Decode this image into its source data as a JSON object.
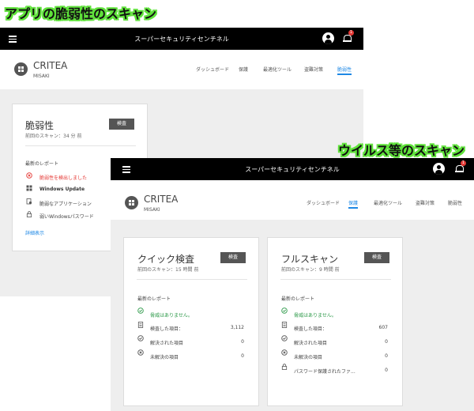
{
  "captions": {
    "top": "アプリの脆弱性のスキャン",
    "mid": "ウイルス等のスキャン"
  },
  "app_title": "スーパーセキュリティセンチネル",
  "notification_count": "1",
  "brand": "CRITEA",
  "user": "MISAKI",
  "nav": [
    "ダッシュボード",
    "保護",
    "最適化ツール",
    "盗難対策",
    "脆弱性"
  ],
  "screen1": {
    "active_tab": "脆弱性",
    "card": {
      "title": "脆弱性",
      "last_scan": "前回のスキャン：34 分 前",
      "button": "検査",
      "report_heading": "最新のレポート",
      "rows": [
        "脆弱性を検出しました",
        "Windows Update",
        "脆弱なアプリケーション",
        "弱いWindowsパスワード"
      ],
      "details_link": "詳細表示"
    }
  },
  "screen2": {
    "active_tab": "保護",
    "quick": {
      "title": "クイック検査",
      "last_scan": "前回のスキャン：15 時間 前",
      "button": "検査",
      "report_heading": "最新のレポート",
      "rows": [
        {
          "label": "脅威はありません。",
          "value": ""
        },
        {
          "label": "検査した項目：",
          "value": "3,112"
        },
        {
          "label": "解決された項目",
          "value": "0"
        },
        {
          "label": "未解決の項目",
          "value": "0"
        }
      ]
    },
    "full": {
      "title": "フルスキャン",
      "last_scan": "前回のスキャン：9 時間 前",
      "button": "検査",
      "report_heading": "最新のレポート",
      "rows": [
        {
          "label": "脅威はありません。",
          "value": ""
        },
        {
          "label": "検査した項目：",
          "value": "607"
        },
        {
          "label": "解決された項目",
          "value": "0"
        },
        {
          "label": "未解決の項目",
          "value": "0"
        },
        {
          "label": "パスワード保護されたファ...",
          "value": "0"
        }
      ]
    }
  },
  "colors": {
    "accent": "#1e88e5",
    "alert": "#e53935",
    "ok": "#2e9a4a",
    "caption_outline": "#5fe23a"
  }
}
